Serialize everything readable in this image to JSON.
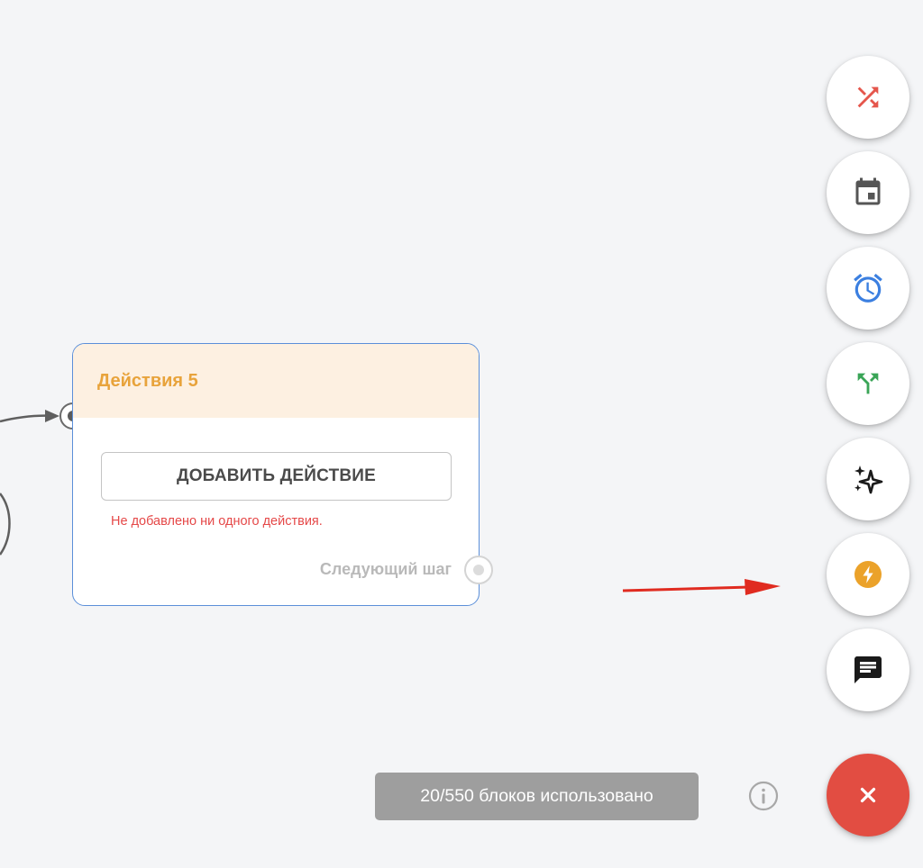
{
  "node": {
    "title": "Действия 5",
    "add_action_label": "ДОБАВИТЬ ДЕЙСТВИЕ",
    "error_message": "Не добавлено ни одного действия.",
    "next_step_label": "Следующий шаг"
  },
  "speed_dial": {
    "buttons": [
      {
        "icon": "shuffle-icon",
        "color": "#e5564c"
      },
      {
        "icon": "calendar-icon",
        "color": "#555555"
      },
      {
        "icon": "alarm-clock-icon",
        "color": "#3b7fe0"
      },
      {
        "icon": "split-arrows-icon",
        "color": "#3aa557"
      },
      {
        "icon": "sparkles-icon",
        "color": "#1a1a1a"
      },
      {
        "icon": "lightning-icon",
        "color": "#eba22a"
      },
      {
        "icon": "chat-message-icon",
        "color": "#1a1a1a"
      }
    ],
    "close_icon": "close-icon",
    "close_color": "#e24d42"
  },
  "footer": {
    "blocks_used_text": "20/550 блоков использовано",
    "info_icon": "info-icon"
  },
  "annotation": {
    "arrow_color": "#e02b20"
  }
}
